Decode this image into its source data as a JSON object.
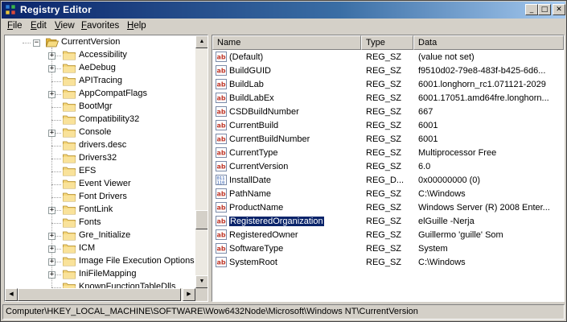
{
  "window": {
    "title": "Registry Editor",
    "min_glyph": "_",
    "max_glyph": "□",
    "close_glyph": "✕"
  },
  "menu": [
    "File",
    "Edit",
    "View",
    "Favorites",
    "Help"
  ],
  "tree": {
    "current": "CurrentVersion",
    "items": [
      {
        "label": "Accessibility",
        "expandable": true
      },
      {
        "label": "AeDebug",
        "expandable": true
      },
      {
        "label": "APITracing",
        "expandable": false
      },
      {
        "label": "AppCompatFlags",
        "expandable": true
      },
      {
        "label": "BootMgr",
        "expandable": false
      },
      {
        "label": "Compatibility32",
        "expandable": false
      },
      {
        "label": "Console",
        "expandable": true
      },
      {
        "label": "drivers.desc",
        "expandable": false
      },
      {
        "label": "Drivers32",
        "expandable": false
      },
      {
        "label": "EFS",
        "expandable": false
      },
      {
        "label": "Event Viewer",
        "expandable": false
      },
      {
        "label": "Font Drivers",
        "expandable": false
      },
      {
        "label": "FontLink",
        "expandable": true
      },
      {
        "label": "Fonts",
        "expandable": false
      },
      {
        "label": "Gre_Initialize",
        "expandable": true
      },
      {
        "label": "ICM",
        "expandable": true
      },
      {
        "label": "Image File Execution Options",
        "expandable": true
      },
      {
        "label": "IniFileMapping",
        "expandable": true
      },
      {
        "label": "KnownFunctionTableDlls",
        "expandable": false
      }
    ],
    "scroll_position": 0.78
  },
  "list": {
    "columns": [
      "Name",
      "Type",
      "Data"
    ],
    "rows": [
      {
        "icon": "string-value-icon",
        "name": "(Default)",
        "type": "REG_SZ",
        "data": "(value not set)"
      },
      {
        "icon": "string-value-icon",
        "name": "BuildGUID",
        "type": "REG_SZ",
        "data": "f9510d02-79e8-483f-b425-6d6..."
      },
      {
        "icon": "string-value-icon",
        "name": "BuildLab",
        "type": "REG_SZ",
        "data": "6001.longhorn_rc1.071121-2029"
      },
      {
        "icon": "string-value-icon",
        "name": "BuildLabEx",
        "type": "REG_SZ",
        "data": "6001.17051.amd64fre.longhorn..."
      },
      {
        "icon": "string-value-icon",
        "name": "CSDBuildNumber",
        "type": "REG_SZ",
        "data": "667"
      },
      {
        "icon": "string-value-icon",
        "name": "CurrentBuild",
        "type": "REG_SZ",
        "data": "6001"
      },
      {
        "icon": "string-value-icon",
        "name": "CurrentBuildNumber",
        "type": "REG_SZ",
        "data": "6001"
      },
      {
        "icon": "string-value-icon",
        "name": "CurrentType",
        "type": "REG_SZ",
        "data": "Multiprocessor Free"
      },
      {
        "icon": "string-value-icon",
        "name": "CurrentVersion",
        "type": "REG_SZ",
        "data": "6.0"
      },
      {
        "icon": "binary-value-icon",
        "name": "InstallDate",
        "type": "REG_D...",
        "data": "0x00000000 (0)"
      },
      {
        "icon": "string-value-icon",
        "name": "PathName",
        "type": "REG_SZ",
        "data": "C:\\Windows"
      },
      {
        "icon": "string-value-icon",
        "name": "ProductName",
        "type": "REG_SZ",
        "data": "Windows Server (R) 2008 Enter..."
      },
      {
        "icon": "string-value-icon",
        "name": "RegisteredOrganization",
        "type": "REG_SZ",
        "data": "elGuille -Nerja",
        "selected": true
      },
      {
        "icon": "string-value-icon",
        "name": "RegisteredOwner",
        "type": "REG_SZ",
        "data": "Guillermo 'guille' Som"
      },
      {
        "icon": "string-value-icon",
        "name": "SoftwareType",
        "type": "REG_SZ",
        "data": "System"
      },
      {
        "icon": "string-value-icon",
        "name": "SystemRoot",
        "type": "REG_SZ",
        "data": "C:\\Windows"
      }
    ]
  },
  "status": {
    "path": "Computer\\HKEY_LOCAL_MACHINE\\SOFTWARE\\Wow6432Node\\Microsoft\\Windows NT\\CurrentVersion"
  },
  "colors": {
    "title_start": "#0a246a",
    "title_end": "#a6caf0",
    "selection": "#0a246a",
    "folder": "#f5d67a",
    "string_icon": "#c0392b",
    "binary_icon": "#1f4fa8"
  }
}
